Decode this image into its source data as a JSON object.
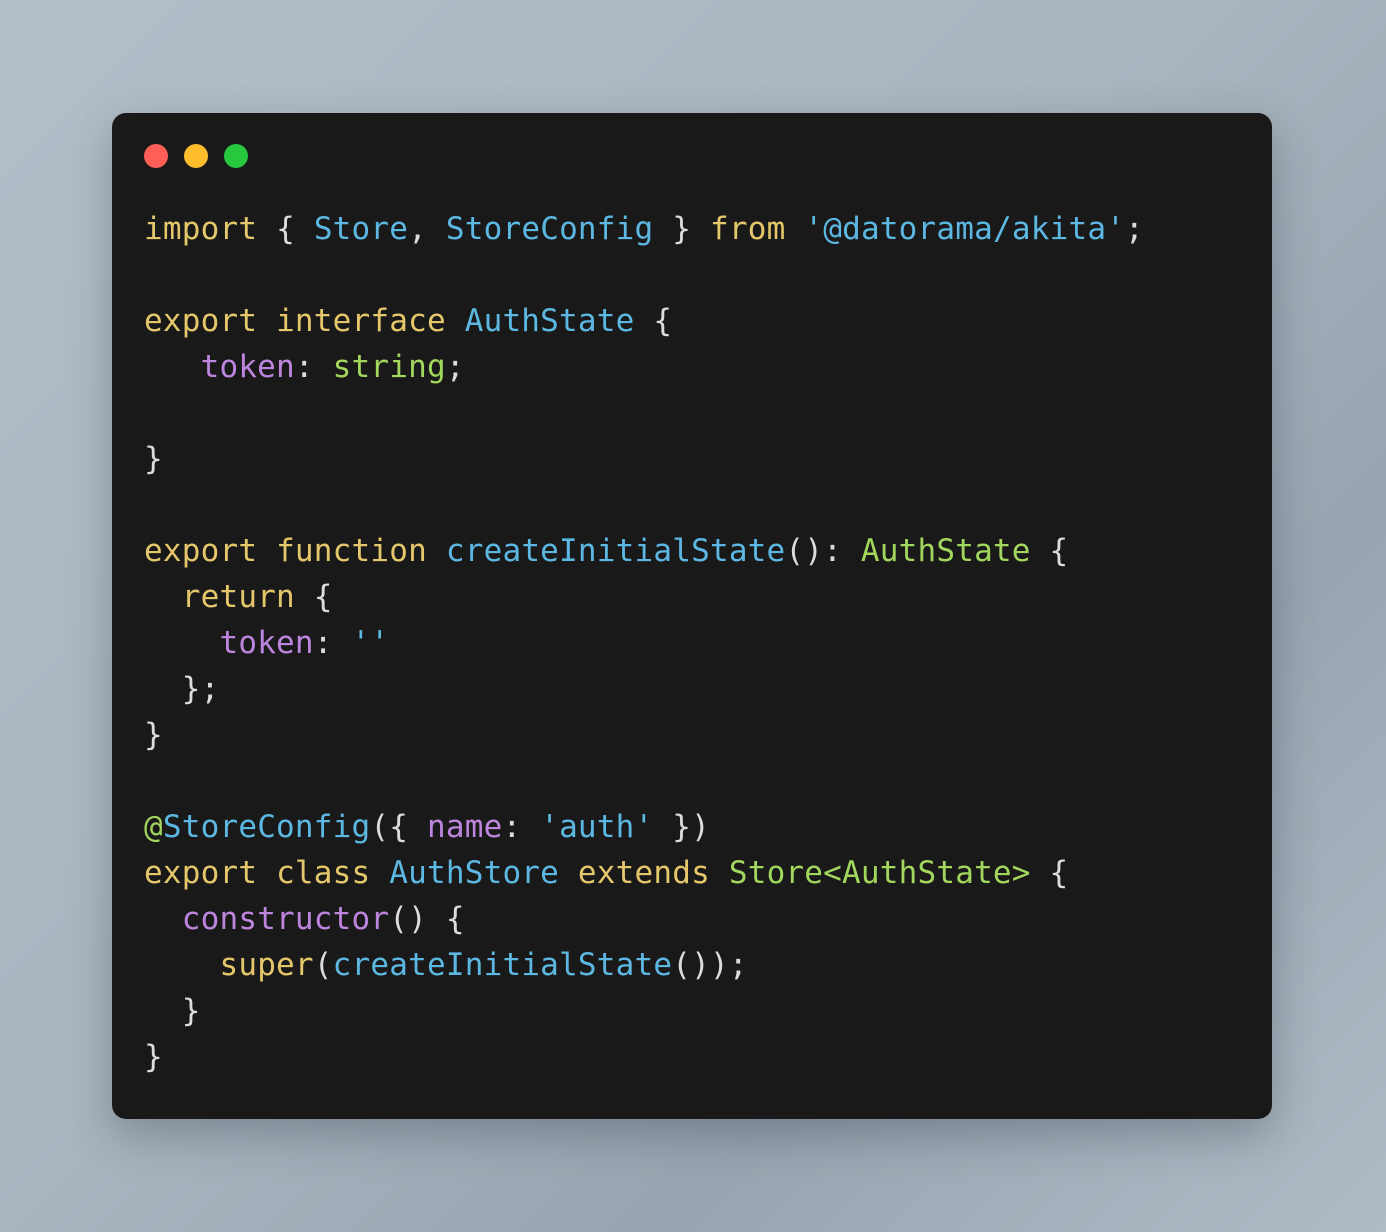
{
  "window": {
    "background_color": "#191919",
    "page_background_color": "#aab5c0",
    "traffic_lights": [
      {
        "name": "close",
        "color": "#ff5f56"
      },
      {
        "name": "minimize",
        "color": "#ffbd2e"
      },
      {
        "name": "maximize",
        "color": "#27c93f"
      }
    ]
  },
  "theme": {
    "keyword": "#e5c76b",
    "type": "#5cb8e2",
    "class_ref": "#a2d65c",
    "property": "#bd85dd",
    "string": "#5cb8e2",
    "plain": "#e6e6e6",
    "decorator_at": "#a2d65c"
  },
  "code": {
    "language": "typescript",
    "full_text": "import { Store, StoreConfig } from '@datorama/akita';\n\nexport interface AuthState {\n   token: string;\n\n}\n\nexport function createInitialState(): AuthState {\n  return {\n    token: ''\n  };\n}\n\n@StoreConfig({ name: 'auth' })\nexport class AuthStore extends Store<AuthState> {\n  constructor() {\n    super(createInitialState());\n  }\n}",
    "lines": [
      {
        "n": 1,
        "tokens": [
          {
            "t": "import",
            "c": "keyword"
          },
          {
            "t": " ",
            "c": "plain"
          },
          {
            "t": "{",
            "c": "punct"
          },
          {
            "t": " ",
            "c": "plain"
          },
          {
            "t": "Store",
            "c": "type"
          },
          {
            "t": ",",
            "c": "punct"
          },
          {
            "t": " ",
            "c": "plain"
          },
          {
            "t": "StoreConfig",
            "c": "type"
          },
          {
            "t": " ",
            "c": "plain"
          },
          {
            "t": "}",
            "c": "punct"
          },
          {
            "t": " ",
            "c": "plain"
          },
          {
            "t": "from",
            "c": "keyword"
          },
          {
            "t": " ",
            "c": "plain"
          },
          {
            "t": "'@datorama/akita'",
            "c": "string"
          },
          {
            "t": ";",
            "c": "punct"
          }
        ]
      },
      {
        "n": 2,
        "tokens": []
      },
      {
        "n": 3,
        "tokens": [
          {
            "t": "export",
            "c": "keyword"
          },
          {
            "t": " ",
            "c": "plain"
          },
          {
            "t": "interface",
            "c": "keyword"
          },
          {
            "t": " ",
            "c": "plain"
          },
          {
            "t": "AuthState",
            "c": "type"
          },
          {
            "t": " ",
            "c": "plain"
          },
          {
            "t": "{",
            "c": "punct"
          }
        ]
      },
      {
        "n": 4,
        "tokens": [
          {
            "t": "   ",
            "c": "plain"
          },
          {
            "t": "token",
            "c": "property"
          },
          {
            "t": ":",
            "c": "punct"
          },
          {
            "t": " ",
            "c": "plain"
          },
          {
            "t": "string",
            "c": "class_ref"
          },
          {
            "t": ";",
            "c": "punct"
          }
        ]
      },
      {
        "n": 5,
        "tokens": []
      },
      {
        "n": 6,
        "tokens": [
          {
            "t": "}",
            "c": "punct"
          }
        ]
      },
      {
        "n": 7,
        "tokens": []
      },
      {
        "n": 8,
        "tokens": [
          {
            "t": "export",
            "c": "keyword"
          },
          {
            "t": " ",
            "c": "plain"
          },
          {
            "t": "function",
            "c": "keyword"
          },
          {
            "t": " ",
            "c": "plain"
          },
          {
            "t": "createInitialState",
            "c": "type"
          },
          {
            "t": "()",
            "c": "punct"
          },
          {
            "t": ":",
            "c": "punct"
          },
          {
            "t": " ",
            "c": "plain"
          },
          {
            "t": "AuthState",
            "c": "class_ref"
          },
          {
            "t": " ",
            "c": "plain"
          },
          {
            "t": "{",
            "c": "punct"
          }
        ]
      },
      {
        "n": 9,
        "tokens": [
          {
            "t": "  ",
            "c": "plain"
          },
          {
            "t": "return",
            "c": "keyword"
          },
          {
            "t": " ",
            "c": "plain"
          },
          {
            "t": "{",
            "c": "punct"
          }
        ]
      },
      {
        "n": 10,
        "tokens": [
          {
            "t": "    ",
            "c": "plain"
          },
          {
            "t": "token",
            "c": "property"
          },
          {
            "t": ":",
            "c": "punct"
          },
          {
            "t": " ",
            "c": "plain"
          },
          {
            "t": "''",
            "c": "string"
          }
        ]
      },
      {
        "n": 11,
        "tokens": [
          {
            "t": "  ",
            "c": "plain"
          },
          {
            "t": "};",
            "c": "punct"
          }
        ]
      },
      {
        "n": 12,
        "tokens": [
          {
            "t": "}",
            "c": "punct"
          }
        ]
      },
      {
        "n": 13,
        "tokens": []
      },
      {
        "n": 14,
        "tokens": [
          {
            "t": "@",
            "c": "decorator_at"
          },
          {
            "t": "StoreConfig",
            "c": "type"
          },
          {
            "t": "({",
            "c": "punct"
          },
          {
            "t": " ",
            "c": "plain"
          },
          {
            "t": "name",
            "c": "property"
          },
          {
            "t": ":",
            "c": "punct"
          },
          {
            "t": " ",
            "c": "plain"
          },
          {
            "t": "'auth'",
            "c": "string"
          },
          {
            "t": " ",
            "c": "plain"
          },
          {
            "t": "})",
            "c": "punct"
          }
        ]
      },
      {
        "n": 15,
        "tokens": [
          {
            "t": "export",
            "c": "keyword"
          },
          {
            "t": " ",
            "c": "plain"
          },
          {
            "t": "class",
            "c": "keyword"
          },
          {
            "t": " ",
            "c": "plain"
          },
          {
            "t": "AuthStore",
            "c": "type"
          },
          {
            "t": " ",
            "c": "plain"
          },
          {
            "t": "extends",
            "c": "keyword"
          },
          {
            "t": " ",
            "c": "plain"
          },
          {
            "t": "Store<AuthState>",
            "c": "class_ref"
          },
          {
            "t": " ",
            "c": "plain"
          },
          {
            "t": "{",
            "c": "punct"
          }
        ]
      },
      {
        "n": 16,
        "tokens": [
          {
            "t": "  ",
            "c": "plain"
          },
          {
            "t": "constructor",
            "c": "property"
          },
          {
            "t": "()",
            "c": "punct"
          },
          {
            "t": " ",
            "c": "plain"
          },
          {
            "t": "{",
            "c": "punct"
          }
        ]
      },
      {
        "n": 17,
        "tokens": [
          {
            "t": "    ",
            "c": "plain"
          },
          {
            "t": "super",
            "c": "keyword"
          },
          {
            "t": "(",
            "c": "punct"
          },
          {
            "t": "createInitialState",
            "c": "type"
          },
          {
            "t": "())",
            "c": "punct"
          },
          {
            "t": ";",
            "c": "punct"
          }
        ]
      },
      {
        "n": 18,
        "tokens": [
          {
            "t": "  ",
            "c": "plain"
          },
          {
            "t": "}",
            "c": "punct"
          }
        ]
      },
      {
        "n": 19,
        "tokens": [
          {
            "t": "}",
            "c": "punct"
          }
        ]
      }
    ]
  }
}
